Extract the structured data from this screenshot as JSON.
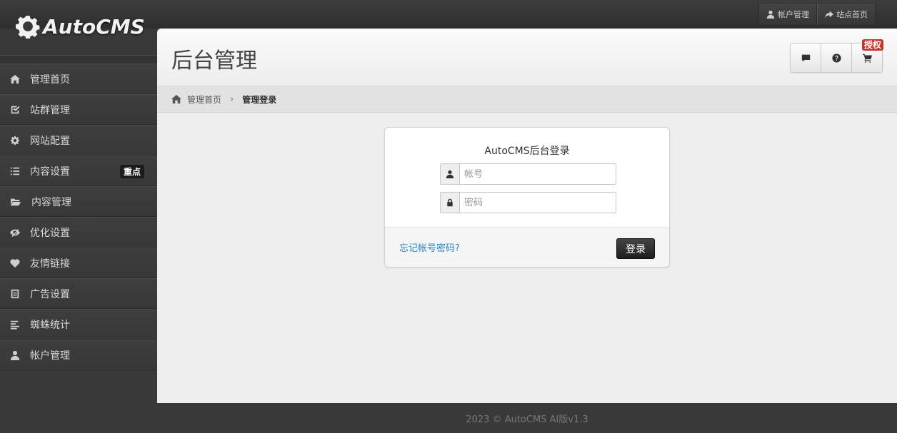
{
  "brand": {
    "name": "AutoCMS"
  },
  "top_links": [
    {
      "label": "帐户管理",
      "icon": "user-icon"
    },
    {
      "label": "站点首页",
      "icon": "share-icon"
    }
  ],
  "sidebar": {
    "items": [
      {
        "label": "管理首页",
        "icon": "home-icon"
      },
      {
        "label": "站群管理",
        "icon": "check-icon"
      },
      {
        "label": "网站配置",
        "icon": "gear-icon"
      },
      {
        "label": "内容设置",
        "icon": "list-icon",
        "badge": "重点"
      },
      {
        "label": "内容管理",
        "icon": "folder-open-icon"
      },
      {
        "label": "优化设置",
        "icon": "eye-slash-icon"
      },
      {
        "label": "友情链接",
        "icon": "heart-icon"
      },
      {
        "label": "广告设置",
        "icon": "document-icon"
      },
      {
        "label": "蜘蛛统计",
        "icon": "align-left-icon"
      },
      {
        "label": "帐户管理",
        "icon": "user-icon"
      }
    ]
  },
  "header": {
    "title": "后台管理",
    "buttons": [
      "comment-icon",
      "question-icon",
      "cart-icon"
    ],
    "auth_badge": "授权"
  },
  "breadcrumb": {
    "home": "管理首页",
    "current": "管理登录"
  },
  "login": {
    "title": "AutoCMS后台登录",
    "username_placeholder": "帐号",
    "password_placeholder": "密码",
    "forgot": "忘记帐号密码?",
    "submit": "登录"
  },
  "footer": {
    "text": "2023 © AutoCMS AI版v1.3"
  },
  "colors": {
    "accent_link": "#2a83c6",
    "badge_red": "#c9302c",
    "sidebar_bg": "#393939"
  }
}
